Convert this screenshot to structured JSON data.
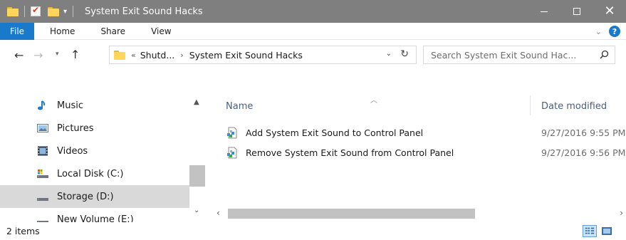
{
  "window": {
    "title": "System Exit Sound Hacks"
  },
  "ribbon": {
    "tabs": [
      "File",
      "Home",
      "Share",
      "View"
    ]
  },
  "address": {
    "overflow_marker": "«",
    "crumbs": [
      "Shutd...",
      "System Exit Sound Hacks"
    ],
    "separator": "›"
  },
  "search": {
    "placeholder": "Search System Exit Sound Hac..."
  },
  "nav": {
    "items": [
      {
        "label": "Music",
        "icon": "music-note-icon"
      },
      {
        "label": "Pictures",
        "icon": "pictures-icon"
      },
      {
        "label": "Videos",
        "icon": "videos-icon"
      },
      {
        "label": "Local Disk (C:)",
        "icon": "local-disk-icon"
      },
      {
        "label": "Storage (D:)",
        "icon": "drive-icon",
        "selected": true
      },
      {
        "label": "New Volume (E:)",
        "icon": "drive-icon"
      }
    ]
  },
  "files": {
    "columns": {
      "name": "Name",
      "date": "Date modified"
    },
    "rows": [
      {
        "name": "Add System Exit Sound to Control Panel",
        "date": "9/27/2016 9:55 PM",
        "icon": "registry-file-icon"
      },
      {
        "name": "Remove System Exit Sound from Control Panel",
        "date": "9/27/2016 9:56 PM",
        "icon": "registry-file-icon"
      }
    ]
  },
  "status": {
    "item_count": "2 items"
  },
  "colors": {
    "titlebar": "#7f7f7f",
    "file_tab": "#1979ca",
    "selection": "#d9d9d9",
    "header_text": "#4c607a"
  }
}
